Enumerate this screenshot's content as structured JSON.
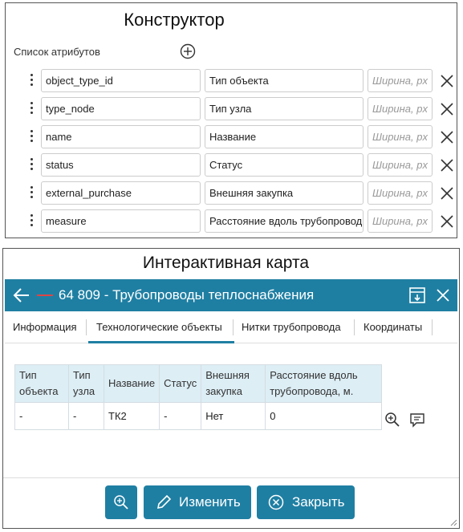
{
  "constructor": {
    "title": "Конструктор",
    "attributes_label": "Список атрибутов",
    "width_placeholder": "Ширина, px",
    "rows": [
      {
        "key": "object_type_id",
        "name": "Тип объекта"
      },
      {
        "key": "type_node",
        "name": "Тип узла"
      },
      {
        "key": "name",
        "name": "Название"
      },
      {
        "key": "status",
        "name": "Статус"
      },
      {
        "key": "external_purchase",
        "name": "Внешняя закупка"
      },
      {
        "key": "measure",
        "name": "Расстояние вдоль трубопровод"
      }
    ]
  },
  "map": {
    "title": "Интерактивная карта",
    "header_title": "64 809 - Трубопроводы теплоснабжения",
    "tabs": [
      "Информация",
      "Технологические объекты",
      "Нитки трубопровода",
      "Координаты"
    ],
    "active_tab": "Технологические объекты",
    "table": {
      "headers": [
        "Тип объекта",
        "Тип узла",
        "Название",
        "Статус",
        "Внешняя закупка",
        "Расстояние вдоль трубопровода, м."
      ],
      "rows": [
        [
          "-",
          "-",
          "ТК2",
          "-",
          "Нет",
          "0"
        ]
      ]
    },
    "buttons": {
      "edit": "Изменить",
      "close": "Закрыть"
    },
    "colors": {
      "accent": "#1f7fa3",
      "header_bg": "#ddeef5",
      "route_line": "#dd4444"
    }
  }
}
